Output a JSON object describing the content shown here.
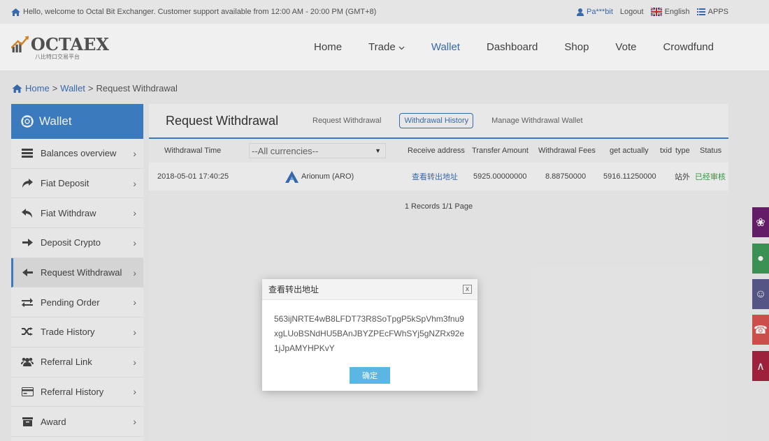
{
  "topbar": {
    "welcome": "Hello, welcome to Octal Bit Exchanger. Customer support available from 12:00 AM - 20:00 PM (GMT+8)",
    "user": "Pa***bit",
    "logout": "Logout",
    "language": "English",
    "apps": "APPS"
  },
  "logo": {
    "text": "OCTAEX",
    "subtitle": "八比特口交易平台"
  },
  "nav": {
    "items": [
      "Home",
      "Trade",
      "Wallet",
      "Dashboard",
      "Shop",
      "Vote",
      "Crowdfund"
    ]
  },
  "breadcrumb": {
    "home": "Home",
    "sep1": ">",
    "wallet": "Wallet",
    "sep2": ">",
    "current": "Request Withdrawal"
  },
  "sidebar": {
    "title": "Wallet",
    "items": [
      {
        "label": "Balances overview",
        "icon": "list-icon"
      },
      {
        "label": "Fiat Deposit",
        "icon": "share-arrow-icon"
      },
      {
        "label": "Fiat Withdraw",
        "icon": "reply-arrow-icon"
      },
      {
        "label": "Deposit Crypto",
        "icon": "arrow-right-icon"
      },
      {
        "label": "Request Withdrawal",
        "icon": "arrow-left-icon"
      },
      {
        "label": "Pending Order",
        "icon": "exchange-icon"
      },
      {
        "label": "Trade History",
        "icon": "shuffle-icon"
      },
      {
        "label": "Referral Link",
        "icon": "users-icon"
      },
      {
        "label": "Referral History",
        "icon": "credit-card-icon"
      },
      {
        "label": "Award",
        "icon": "archive-icon"
      }
    ]
  },
  "main": {
    "title": "Request Withdrawal",
    "tabs": [
      "Request Withdrawal",
      "Withdrawal History",
      "Manage Withdrawal Wallet"
    ],
    "active_tab": "Withdrawal History",
    "columns": {
      "time": "Withdrawal Time",
      "currency_select": "--All currencies--",
      "address": "Receive address",
      "amount": "Transfer Amount",
      "fees": "Withdrawal Fees",
      "actual": "get actually",
      "txid": "txid",
      "type": "type",
      "status": "Status"
    },
    "rows": [
      {
        "time": "2018-05-01 17:40:25",
        "currency": "Arionum (ARO)",
        "address_link": "查看转出地址",
        "amount": "5925.00000000",
        "fees": "8.88750000",
        "actual": "5916.11250000",
        "type": "站外",
        "status": "已经审核"
      }
    ],
    "records": "1 Records 1/1 Page"
  },
  "modal": {
    "title": "查看转出地址",
    "close": "x",
    "address": "563ijNRTE4wB8LFDT73R8SoTpgP5kSpVhm3fnu9xgLUoBSNdHU5BAnJBYZPEcFWhSYj5gNZRx92e1jJpAMYHPKvY",
    "confirm": "确定"
  },
  "colors": {
    "accent": "#3e82c9",
    "link": "#3b6fb6",
    "status_ok": "#37a447",
    "float_tools": [
      "#6a1f6e",
      "#3f9a5a",
      "#5a5a8e",
      "#d9534f",
      "#a8243f"
    ]
  }
}
